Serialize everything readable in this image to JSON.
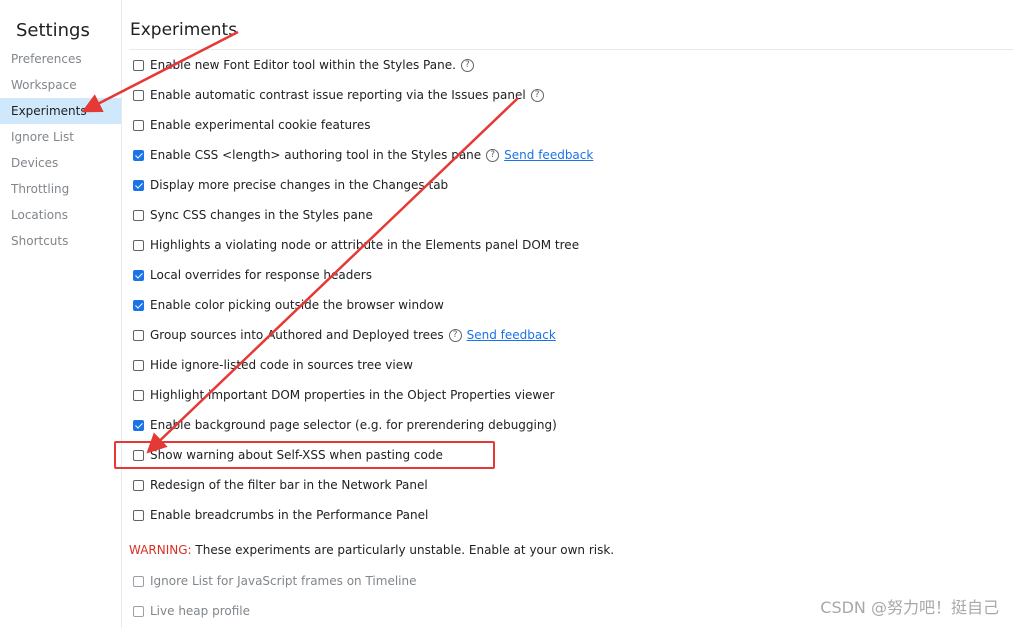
{
  "sidebar": {
    "title": "Settings",
    "items": [
      {
        "label": "Preferences",
        "selected": false
      },
      {
        "label": "Workspace",
        "selected": false
      },
      {
        "label": "Experiments",
        "selected": true
      },
      {
        "label": "Ignore List",
        "selected": false
      },
      {
        "label": "Devices",
        "selected": false
      },
      {
        "label": "Throttling",
        "selected": false
      },
      {
        "label": "Locations",
        "selected": false
      },
      {
        "label": "Shortcuts",
        "selected": false
      }
    ]
  },
  "main": {
    "title": "Experiments",
    "experiments": [
      {
        "label": "Enable new Font Editor tool within the Styles Pane.",
        "checked": false,
        "help": true,
        "feedback": ""
      },
      {
        "label": "Enable automatic contrast issue reporting via the Issues panel",
        "checked": false,
        "help": true,
        "feedback": ""
      },
      {
        "label": "Enable experimental cookie features",
        "checked": false,
        "help": false,
        "feedback": ""
      },
      {
        "label": "Enable CSS <length> authoring tool in the Styles pane",
        "checked": true,
        "help": true,
        "feedback": "Send feedback"
      },
      {
        "label": "Display more precise changes in the Changes tab",
        "checked": true,
        "help": false,
        "feedback": ""
      },
      {
        "label": "Sync CSS changes in the Styles pane",
        "checked": false,
        "help": false,
        "feedback": ""
      },
      {
        "label": "Highlights a violating node or attribute in the Elements panel DOM tree",
        "checked": false,
        "help": false,
        "feedback": ""
      },
      {
        "label": "Local overrides for response headers",
        "checked": true,
        "help": false,
        "feedback": ""
      },
      {
        "label": "Enable color picking outside the browser window",
        "checked": true,
        "help": false,
        "feedback": ""
      },
      {
        "label": "Group sources into Authored and Deployed trees",
        "checked": false,
        "help": true,
        "feedback": "Send feedback"
      },
      {
        "label": "Hide ignore-listed code in sources tree view",
        "checked": false,
        "help": false,
        "feedback": ""
      },
      {
        "label": "Highlight important DOM properties in the Object Properties viewer",
        "checked": false,
        "help": false,
        "feedback": ""
      },
      {
        "label": "Enable background page selector (e.g. for prerendering debugging)",
        "checked": true,
        "help": false,
        "feedback": ""
      },
      {
        "label": "Show warning about Self-XSS when pasting code",
        "checked": false,
        "help": false,
        "feedback": ""
      },
      {
        "label": "Redesign of the filter bar in the Network Panel",
        "checked": false,
        "help": false,
        "feedback": ""
      },
      {
        "label": "Enable breadcrumbs in the Performance Panel",
        "checked": false,
        "help": false,
        "feedback": ""
      }
    ],
    "warning_label": "WARNING:",
    "warning_text": " These experiments are particularly unstable. Enable at your own risk.",
    "unstable_experiments": [
      {
        "label": "Ignore List for JavaScript frames on Timeline",
        "checked": false
      },
      {
        "label": "Live heap profile",
        "checked": false
      }
    ]
  },
  "help_glyph": "?",
  "watermark": "CSDN @努力吧！挺自己",
  "colors": {
    "accent": "#1a73e8",
    "selected_bg": "#cfe8fc",
    "warning": "#d93025",
    "annotation": "#e53935"
  }
}
